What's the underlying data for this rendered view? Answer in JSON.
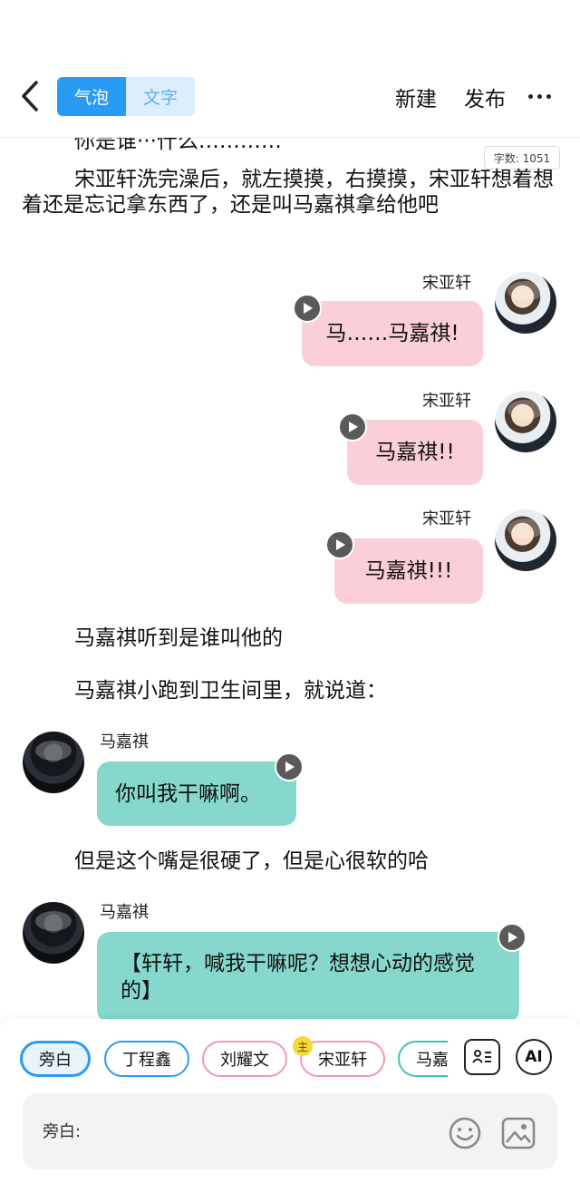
{
  "header": {
    "tab_bubble": "气泡",
    "tab_text": "文字",
    "new_label": "新建",
    "publish_label": "发布"
  },
  "word_count": "字数: 1051",
  "narration": {
    "partial_top": "你是谁···什么…………",
    "p1": "宋亚轩洗完澡后，就左摸摸，右摸摸，宋亚轩想着想着还是忘记拿东西了，还是叫马嘉祺拿给他吧",
    "p2": "马嘉祺听到是谁叫他的",
    "p3": "马嘉祺小跑到卫生间里，就说道：",
    "p4": "但是这个嘴是很硬了，但是心很软的哈"
  },
  "messages": [
    {
      "speaker": "宋亚轩",
      "text": "马……马嘉祺!"
    },
    {
      "speaker": "宋亚轩",
      "text": "马嘉祺!!"
    },
    {
      "speaker": "宋亚轩",
      "text": "马嘉祺!!!"
    },
    {
      "speaker": "马嘉祺",
      "text": "你叫我干嘛啊。"
    },
    {
      "speaker": "马嘉祺",
      "text": "【轩轩，喊我干嘛呢？想想心动的感觉的】"
    }
  ],
  "characters": [
    {
      "name": "旁白",
      "color": "#2a9bf3"
    },
    {
      "name": "丁程鑫",
      "color": "#2a9bf3"
    },
    {
      "name": "刘耀文",
      "color": "#f29aa8"
    },
    {
      "name": "宋亚轩",
      "color": "#f29aa8"
    },
    {
      "name": "马嘉祺",
      "color": "#3cc6b4"
    }
  ],
  "main_badge": "主",
  "ai_label": "AI",
  "input": {
    "placeholder": "旁白:"
  },
  "icons": {
    "back": "chevron-left-icon",
    "more": "more-dots-icon",
    "play": "play-icon",
    "character_card": "character-card-icon",
    "emoji": "emoji-icon",
    "image": "image-icon"
  }
}
